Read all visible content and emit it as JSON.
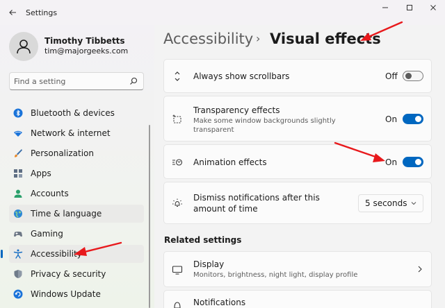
{
  "window": {
    "title": "Settings",
    "controls": [
      "minimize",
      "maximize",
      "close"
    ]
  },
  "user": {
    "name": "Timothy Tibbetts",
    "email": "tim@majorgeeks.com"
  },
  "search": {
    "placeholder": "Find a setting"
  },
  "nav": {
    "items": [
      {
        "label": "Bluetooth & devices",
        "icon": "bluetooth-icon"
      },
      {
        "label": "Network & internet",
        "icon": "wifi-icon"
      },
      {
        "label": "Personalization",
        "icon": "brush-icon"
      },
      {
        "label": "Apps",
        "icon": "apps-icon"
      },
      {
        "label": "Accounts",
        "icon": "person-icon"
      },
      {
        "label": "Time & language",
        "icon": "globe-icon"
      },
      {
        "label": "Gaming",
        "icon": "gamepad-icon"
      },
      {
        "label": "Accessibility",
        "icon": "accessibility-icon"
      },
      {
        "label": "Privacy & security",
        "icon": "shield-icon"
      },
      {
        "label": "Windows Update",
        "icon": "update-icon"
      }
    ],
    "active_index": 7,
    "highlighted_index": 5
  },
  "breadcrumb": {
    "parent": "Accessibility",
    "separator": "›",
    "current": "Visual effects"
  },
  "settings": {
    "scrollbars": {
      "title": "Always show scrollbars",
      "state": "Off"
    },
    "transparency": {
      "title": "Transparency effects",
      "description": "Make some window backgrounds slightly transparent",
      "state": "On"
    },
    "animation": {
      "title": "Animation effects",
      "state": "On"
    },
    "dismiss": {
      "title": "Dismiss notifications after this amount of time",
      "value": "5 seconds"
    }
  },
  "related": {
    "heading": "Related settings",
    "display": {
      "title": "Display",
      "description": "Monitors, brightness, night light, display profile"
    },
    "notifications": {
      "title": "Notifications"
    }
  },
  "colors": {
    "accent": "#0067c0",
    "annotation_arrow": "#e8191c"
  }
}
